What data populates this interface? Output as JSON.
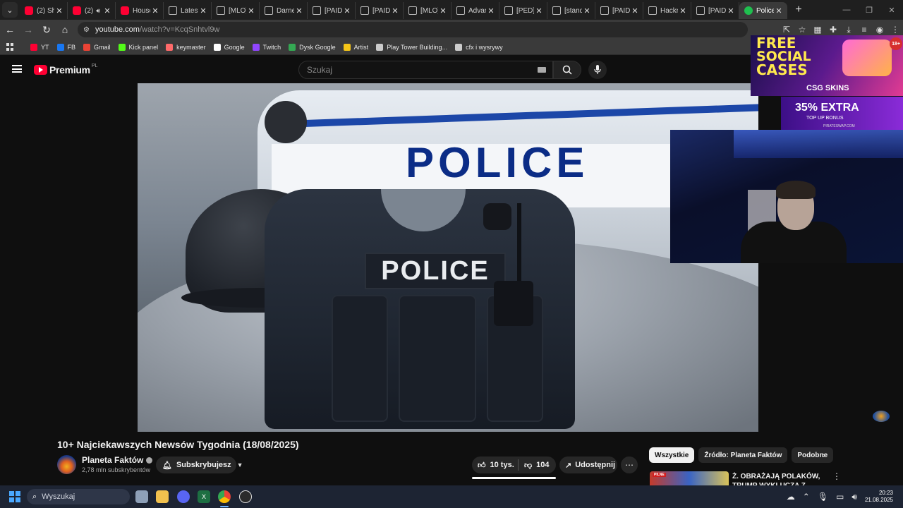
{
  "browser": {
    "tabs": [
      {
        "title": "(2) Sh",
        "icon": "youtube-icon",
        "active": false
      },
      {
        "title": "(2)",
        "icon": "youtube-icon",
        "audio": true,
        "active": false
      },
      {
        "title": "House",
        "icon": "youtube-icon",
        "active": false
      },
      {
        "title": "Latest",
        "icon": "page-icon",
        "active": false
      },
      {
        "title": "[MLO]",
        "icon": "page-icon",
        "active": false
      },
      {
        "title": "Darne",
        "icon": "page-icon",
        "active": false
      },
      {
        "title": "[PAID]",
        "icon": "page-icon",
        "active": false
      },
      {
        "title": "[PAID]",
        "icon": "page-icon",
        "active": false
      },
      {
        "title": "[MLO]",
        "icon": "page-icon",
        "active": false
      },
      {
        "title": "Advan",
        "icon": "page-icon",
        "active": false
      },
      {
        "title": "[PED]",
        "icon": "page-icon",
        "active": false
      },
      {
        "title": "[stand",
        "icon": "page-icon",
        "active": false
      },
      {
        "title": "[PAID]",
        "icon": "page-icon",
        "active": false
      },
      {
        "title": "Hackr",
        "icon": "page-icon",
        "active": false
      },
      {
        "title": "[PAID]",
        "icon": "page-icon",
        "active": false
      },
      {
        "title": "Police",
        "icon": "green-site-icon",
        "active": true
      }
    ],
    "url_host": "youtube.com",
    "url_path": "/watch?v=KcqSnhtvl9w",
    "bookmarks": [
      {
        "label": "YT",
        "icon": "youtube-icon",
        "color": "#ff0033"
      },
      {
        "label": "FB",
        "icon": "facebook-icon",
        "color": "#1877f2"
      },
      {
        "label": "Gmail",
        "icon": "gmail-icon",
        "color": "#ea4335"
      },
      {
        "label": "Kick panel",
        "icon": "kick-icon",
        "color": "#53fc18"
      },
      {
        "label": "keymaster",
        "icon": "keymaster-icon",
        "color": "#ff6a6a"
      },
      {
        "label": "Google",
        "icon": "google-icon",
        "color": "#ffffff"
      },
      {
        "label": "Twitch",
        "icon": "twitch-icon",
        "color": "#9146ff"
      },
      {
        "label": "Dysk Google",
        "icon": "drive-icon",
        "color": "#34a853"
      },
      {
        "label": "Artist",
        "icon": "artist-icon",
        "color": "#f5c518"
      },
      {
        "label": "Play Tower Building...",
        "icon": "game-icon",
        "color": "#cccccc"
      },
      {
        "label": "cfx i wysrywy",
        "icon": "folder-icon",
        "color": "#cccccc"
      }
    ]
  },
  "youtube": {
    "logo_text": "Premium",
    "country_code": "PL",
    "search_placeholder": "Szukaj",
    "video_overlay_text": "POLICE",
    "title": "10+ Najciekawszych Newsów Tygodnia (18/08/2025)",
    "channel": {
      "name": "Planeta Faktów",
      "subscribers": "2,78 mln subskrybentów",
      "subscribe_label": "Subskrybujesz"
    },
    "likes": "10 tys.",
    "dislikes": "104",
    "share_label": "Udostępnij",
    "chips": [
      "Wszystkie",
      "Źródło: Planeta Faktów",
      "Podobne"
    ],
    "recommended": {
      "title": "Ż. OBRAŻAJĄ POLAKÓW, TRUMP WYKLUCZA Z ROZMÓ",
      "thumb_tag": "PILNE"
    }
  },
  "ads": {
    "ad1_line1": "FREE",
    "ad1_line2": "SOCIAL",
    "ad1_line3": "CASES",
    "ad1_brand": "CSG SKINS",
    "ad1_age": "18+",
    "ad2_line1": "35% EXTRA",
    "ad2_line2": "TOP UP BONUS",
    "ad2_site": "PIRATESWAP.COM"
  },
  "taskbar": {
    "search_label": "Wyszukaj",
    "time": "20:23",
    "date": "21.08.2025"
  }
}
